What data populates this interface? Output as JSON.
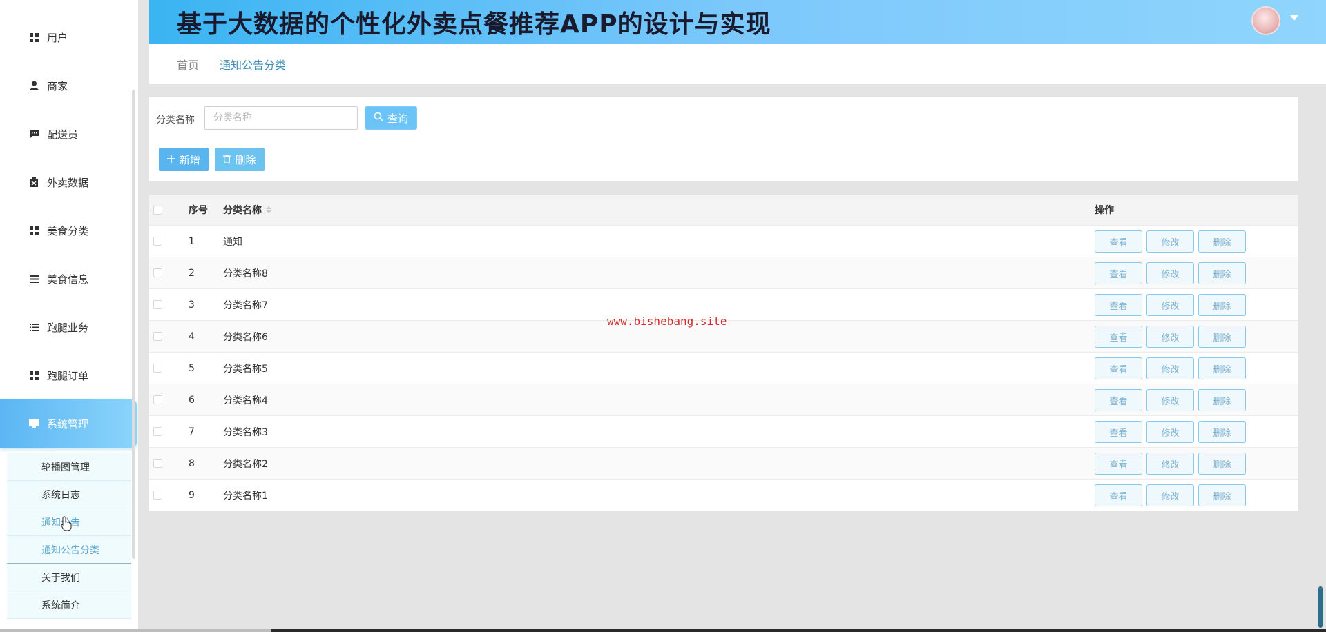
{
  "header": {
    "title": "基于大数据的个性化外卖点餐推荐APP的设计与实现"
  },
  "breadcrumb": {
    "home": "首页",
    "current": "通知公告分类"
  },
  "sidebar": {
    "items": [
      {
        "label": "用户",
        "icon": "grid-icon"
      },
      {
        "label": "商家",
        "icon": "user-icon"
      },
      {
        "label": "配送员",
        "icon": "chat-icon"
      },
      {
        "label": "外卖数据",
        "icon": "clipboard-icon"
      },
      {
        "label": "美食分类",
        "icon": "grid-icon"
      },
      {
        "label": "美食信息",
        "icon": "list-icon"
      },
      {
        "label": "跑腿业务",
        "icon": "list-icon"
      },
      {
        "label": "跑腿订单",
        "icon": "grid-icon"
      },
      {
        "label": "系统管理",
        "icon": "monitor-icon"
      }
    ],
    "subitems": [
      "轮播图管理",
      "系统日志",
      "通知公告",
      "通知公告分类",
      "关于我们",
      "系统简介"
    ]
  },
  "search": {
    "label": "分类名称",
    "placeholder": "分类名称",
    "query_button": "查询",
    "add_button": "新增",
    "delete_button": "删除"
  },
  "table": {
    "columns": {
      "index": "序号",
      "name": "分类名称",
      "ops": "操作"
    },
    "actions": {
      "view": "查看",
      "edit": "修改",
      "delete": "删除"
    },
    "rows": [
      {
        "index": "1",
        "name": "通知"
      },
      {
        "index": "2",
        "name": "分类名称8"
      },
      {
        "index": "3",
        "name": "分类名称7"
      },
      {
        "index": "4",
        "name": "分类名称6"
      },
      {
        "index": "5",
        "name": "分类名称5"
      },
      {
        "index": "6",
        "name": "分类名称4"
      },
      {
        "index": "7",
        "name": "分类名称3"
      },
      {
        "index": "8",
        "name": "分类名称2"
      },
      {
        "index": "9",
        "name": "分类名称1"
      }
    ]
  },
  "watermark": "www.bishebang.site",
  "colors": {
    "accent": "#5ab4ee",
    "header_gradient_start": "#3ab4f2",
    "watermark": "#d4282a"
  }
}
